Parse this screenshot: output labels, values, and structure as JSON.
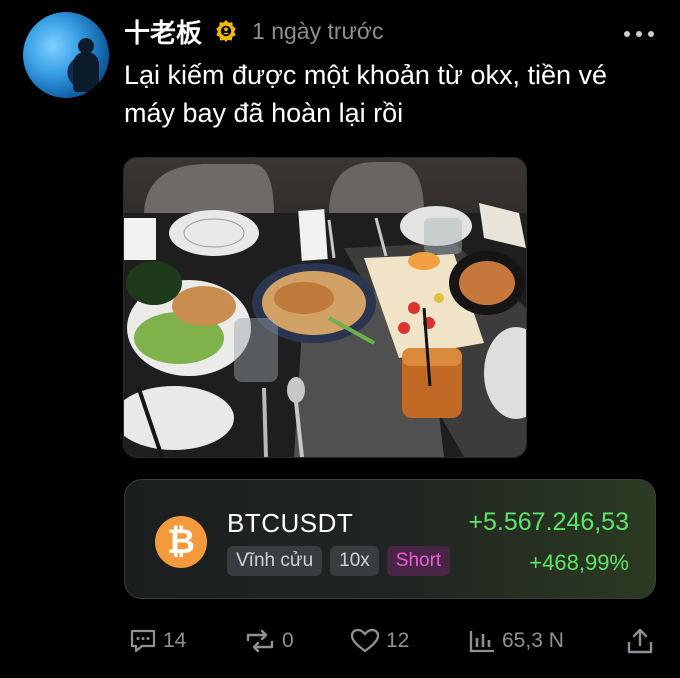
{
  "post": {
    "author": "十老板",
    "time": "1 ngày trước",
    "text": "Lại kiếm được một khoản từ okx, tiền vé máy bay đã hoàn lại rồi"
  },
  "trade_card": {
    "symbol": "BTCUSDT",
    "coin_glyph": "₿",
    "tags": [
      "Vĩnh cửu",
      "10x",
      "Short"
    ],
    "pnl": "+5.567.246,53",
    "pnl_pct": "+468,99%",
    "colors": {
      "profit": "#5fe46a",
      "short": "#ea5fd3",
      "coin": "#f39a3a"
    }
  },
  "actions": {
    "replies": "14",
    "reposts": "0",
    "likes": "12",
    "views": "65,3 N"
  },
  "icons": [
    "verified-badge-icon",
    "more-icon",
    "comment-icon",
    "repost-icon",
    "heart-icon",
    "views-icon",
    "share-icon"
  ]
}
